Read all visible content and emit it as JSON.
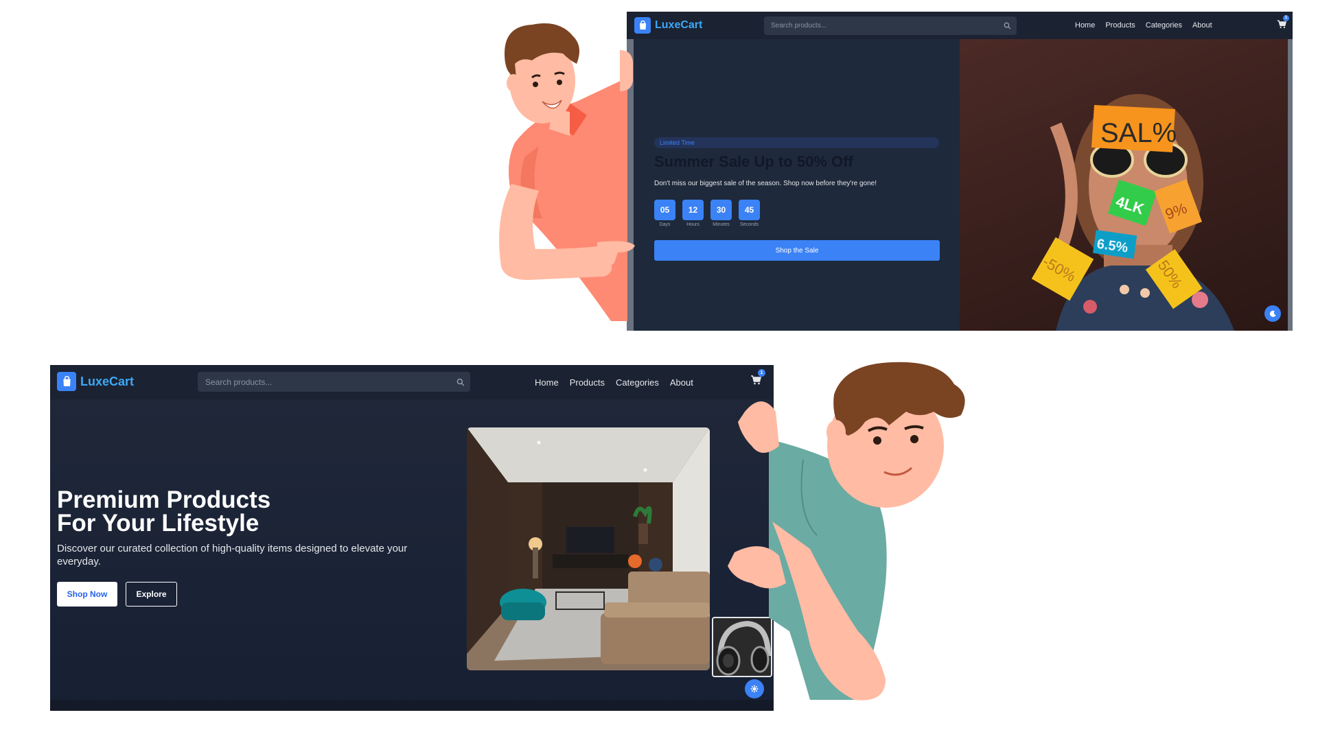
{
  "top_screenshot": {
    "brand": "LuxeCart",
    "search": {
      "placeholder": "Search products..."
    },
    "nav": [
      "Home",
      "Products",
      "Categories",
      "About"
    ],
    "cart_count": "1",
    "badge": "Limited Time",
    "title": "Summer Sale Up to 50% Off",
    "subtitle": "Don't miss our biggest sale of the season. Shop now before they're gone!",
    "countdown": [
      {
        "value": "05",
        "label": "Days"
      },
      {
        "value": "12",
        "label": "Hours"
      },
      {
        "value": "30",
        "label": "Minutes"
      },
      {
        "value": "45",
        "label": "Seconds"
      }
    ],
    "cta": "Shop the Sale",
    "photo_tags": [
      "SAL%",
      "4LK",
      "9%",
      "-50%",
      "6.5%",
      "50%"
    ]
  },
  "bottom_screenshot": {
    "brand": "LuxeCart",
    "search": {
      "placeholder": "Search products..."
    },
    "nav": [
      "Home",
      "Products",
      "Categories",
      "About"
    ],
    "cart_count": "1",
    "title_line1": "Premium Products",
    "title_line2": "For Your Lifestyle",
    "subtitle": "Discover our curated collection of high-quality items designed to elevate your everyday.",
    "primary_button": "Shop Now",
    "secondary_button": "Explore"
  },
  "colors": {
    "accent": "#3b82f6",
    "logo_text": "#3ea9f5",
    "panel_dark": "#1e293b",
    "nav_dark": "#1b2232"
  }
}
